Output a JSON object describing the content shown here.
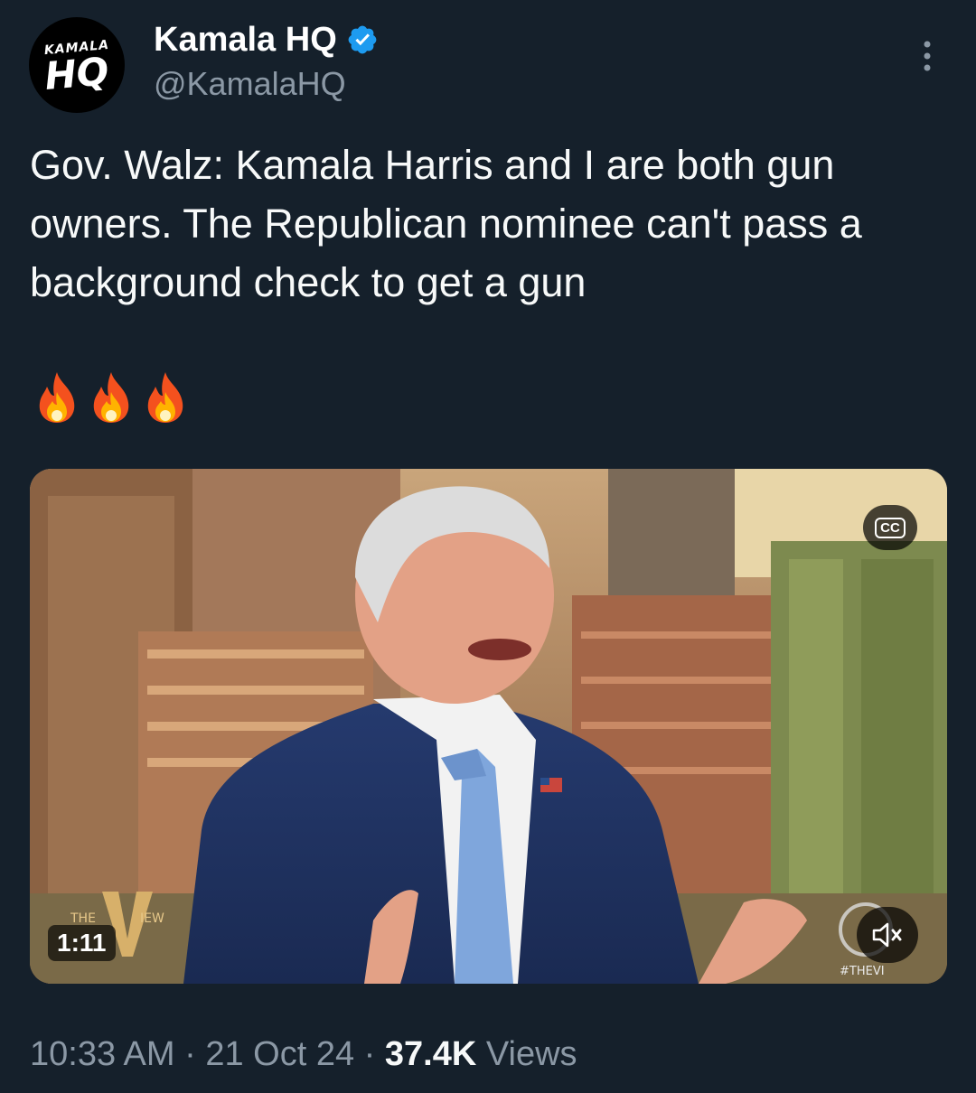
{
  "author": {
    "avatar_text_small": "KAMALA",
    "avatar_text_big": "HQ",
    "display_name": "Kamala HQ",
    "handle": "@KamalaHQ",
    "verified": true,
    "verified_color": "#1d9bf0"
  },
  "tweet": {
    "text": "Gov. Walz: Kamala Harris and I are both gun owners. The Republican nominee can't pass a background check to get a gun",
    "emoji": [
      "🔥",
      "🔥",
      "🔥"
    ]
  },
  "media": {
    "type": "video",
    "duration": "1:11",
    "cc_label": "CC",
    "watermark": "#THEVI",
    "show_logo_text_left": "THE",
    "show_logo_text_right": "IEW"
  },
  "meta": {
    "time": "10:33 AM",
    "separator": "·",
    "date": "21 Oct 24",
    "views_count": "37.4K",
    "views_label": "Views"
  },
  "icons": {
    "more": "more-vertical-icon",
    "verified": "verified-badge-icon",
    "cc": "closed-captions-icon",
    "mute": "muted-speaker-icon"
  },
  "colors": {
    "background": "#15202b",
    "text_primary": "#f7f9f9",
    "text_secondary": "#8b98a5"
  }
}
